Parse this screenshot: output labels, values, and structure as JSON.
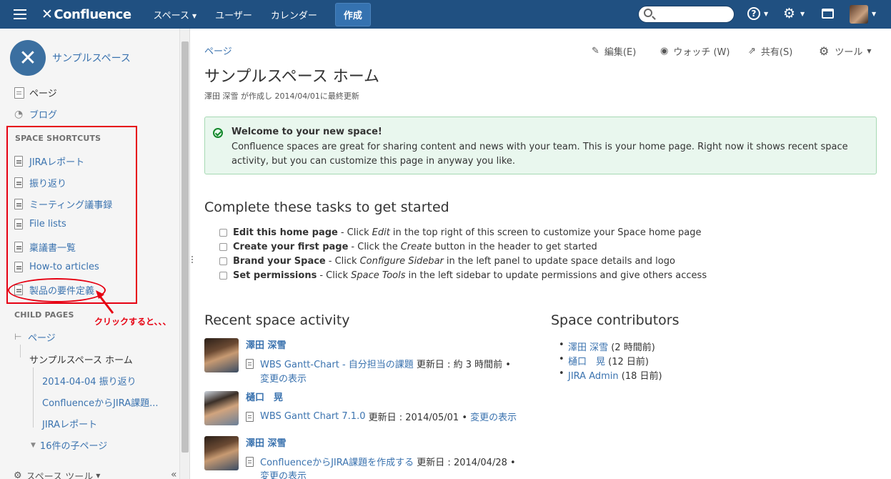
{
  "header": {
    "app_name": "Confluence",
    "nav": [
      "スペース",
      "ユーザー",
      "カレンダー"
    ],
    "create_label": "作成",
    "search_placeholder": "",
    "help_glyph": "?"
  },
  "sidebar": {
    "space_name": "サンプルスペース",
    "main_items": [
      "ページ",
      "ブログ"
    ],
    "shortcuts_heading": "SPACE SHORTCUTS",
    "shortcuts": [
      "JIRAレポート",
      "振り返り",
      "ミーティング議事録",
      "File lists",
      "稟議書一覧",
      "How-to articles",
      "製品の要件定義"
    ],
    "child_pages_heading": "CHILD PAGES",
    "tree": {
      "root": "ページ",
      "current": "サンプルスペース ホーム",
      "children": [
        "2014-04-04 振り返り",
        "ConfluenceからJIRA課題...",
        "JIRAレポート"
      ],
      "more": "16件の子ページ"
    },
    "space_tools": "スペース ツール",
    "annotation": "クリックすると、、、"
  },
  "page": {
    "breadcrumb": "ページ",
    "actions": [
      {
        "label": "編集(E)",
        "icon": "pencil-icon"
      },
      {
        "label": "ウォッチ (W)",
        "icon": "eye-icon"
      },
      {
        "label": "共有(S)",
        "icon": "share-icon"
      },
      {
        "label": "ツール",
        "icon": "gear-icon"
      }
    ],
    "title": "サンプルスペース ホーム",
    "byline": "澤田 深雪 が作成し 2014/04/01に最終更新",
    "welcome_title": "Welcome to your new space!",
    "welcome_body": "Confluence spaces are great for sharing content and news with your team. This is your home page. Right now it shows recent space activity, but you can customize this page in anyway you like.",
    "tasks_heading": "Complete these tasks to get started",
    "tasks": [
      {
        "bold": "Edit this home page",
        "pre": "- Click",
        "em": "Edit",
        "post": "in the top right of this screen to customize your Space home page"
      },
      {
        "bold": "Create your first page",
        "pre": "- Click the",
        "em": "Create",
        "post": "button in the header to get started"
      },
      {
        "bold": "Brand your Space",
        "pre": "- Click",
        "em": "Configure Sidebar",
        "post": "in the left panel to update space details and logo"
      },
      {
        "bold": "Set permissions",
        "pre": "- Click",
        "em": "Space Tools",
        "post": "in the left sidebar to update permissions and give others access"
      }
    ],
    "activity_heading": "Recent space activity",
    "activity": [
      {
        "user": "澤田 深雪",
        "page": "WBS Gantt-Chart - 自分担当の課題",
        "meta": "更新日 : 約 3 時間前 •",
        "view": "変更の表示"
      },
      {
        "user": "樋口　晃",
        "page": "WBS Gantt Chart 7.1.0",
        "meta": "更新日 : 2014/05/01 •",
        "view": "変更の表示"
      },
      {
        "user": "澤田 深雪",
        "page": "ConfluenceからJIRA課題を作成する",
        "meta": "更新日 : 2014/04/28 •",
        "view": "変更の表示"
      }
    ],
    "contributors_heading": "Space contributors",
    "contributors": [
      {
        "name": "澤田 深雪",
        "when": "(2 時間前)"
      },
      {
        "name": "樋口　晃",
        "when": "(12 日前)"
      },
      {
        "name": "JIRA Admin",
        "when": "(18 日前)"
      }
    ]
  }
}
